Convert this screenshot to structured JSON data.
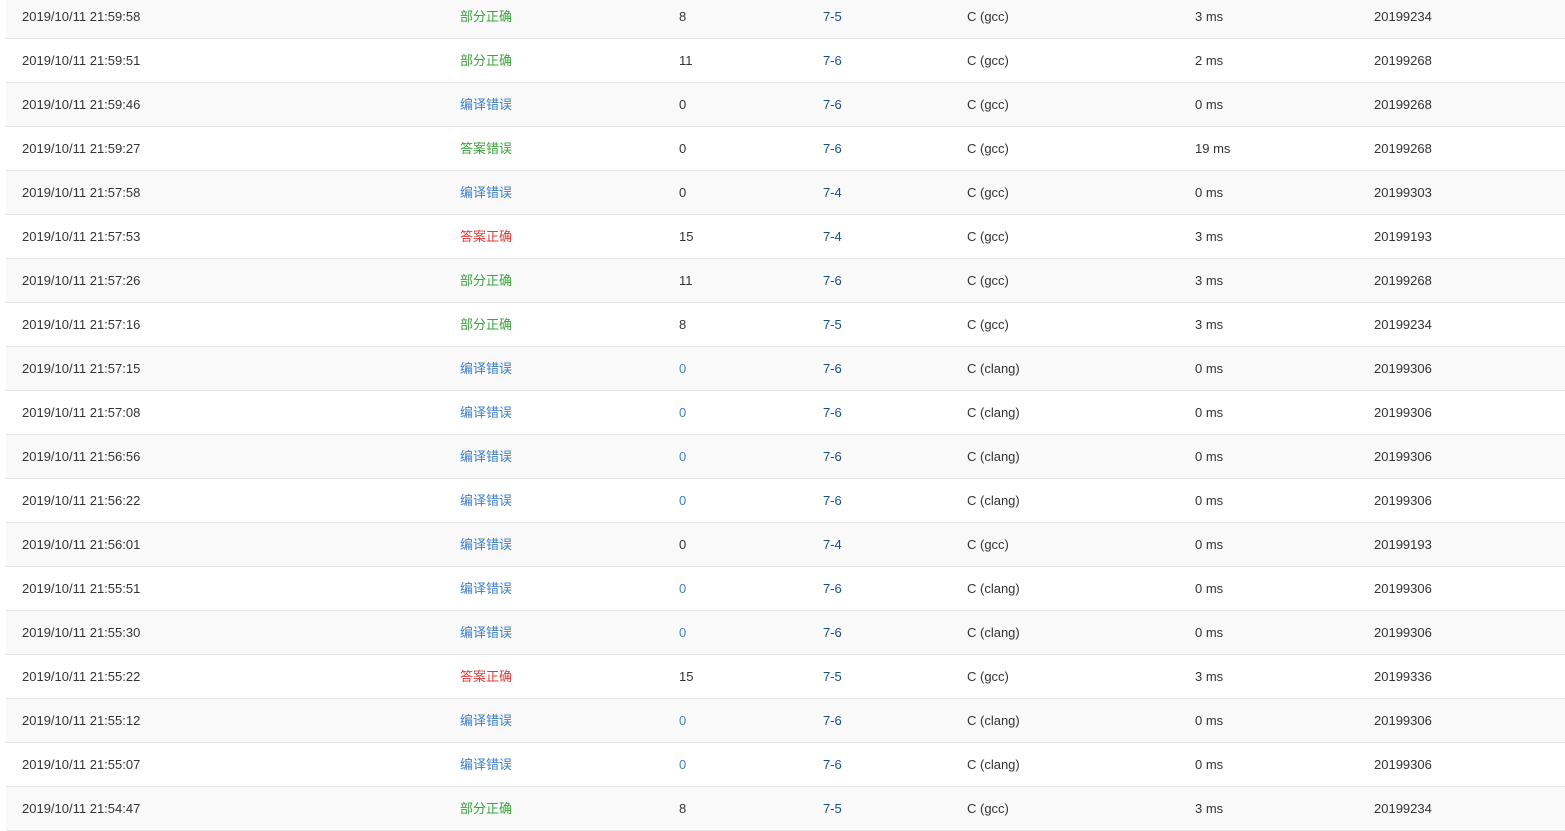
{
  "submissions": {
    "rows": [
      {
        "time": "2019/10/11 21:59:58",
        "status": "部分正确",
        "status_type": "partial",
        "score": "8",
        "problem": "7-5",
        "compiler": "C (gcc)",
        "time_used": "3 ms",
        "user": "20199234"
      },
      {
        "time": "2019/10/11 21:59:51",
        "status": "部分正确",
        "status_type": "partial",
        "score": "11",
        "problem": "7-6",
        "compiler": "C (gcc)",
        "time_used": "2 ms",
        "user": "20199268"
      },
      {
        "time": "2019/10/11 21:59:46",
        "status": "编译错误",
        "status_type": "compile",
        "score": "0",
        "problem": "7-6",
        "compiler": "C (gcc)",
        "time_used": "0 ms",
        "user": "20199268"
      },
      {
        "time": "2019/10/11 21:59:27",
        "status": "答案错误",
        "status_type": "wrong",
        "score": "0",
        "problem": "7-6",
        "compiler": "C (gcc)",
        "time_used": "19 ms",
        "user": "20199268"
      },
      {
        "time": "2019/10/11 21:57:58",
        "status": "编译错误",
        "status_type": "compile",
        "score": "0",
        "problem": "7-4",
        "compiler": "C (gcc)",
        "time_used": "0 ms",
        "user": "20199303"
      },
      {
        "time": "2019/10/11 21:57:53",
        "status": "答案正确",
        "status_type": "accepted",
        "score": "15",
        "problem": "7-4",
        "compiler": "C (gcc)",
        "time_used": "3 ms",
        "user": "20199193"
      },
      {
        "time": "2019/10/11 21:57:26",
        "status": "部分正确",
        "status_type": "partial",
        "score": "11",
        "problem": "7-6",
        "compiler": "C (gcc)",
        "time_used": "3 ms",
        "user": "20199268"
      },
      {
        "time": "2019/10/11 21:57:16",
        "status": "部分正确",
        "status_type": "partial",
        "score": "8",
        "problem": "7-5",
        "compiler": "C (gcc)",
        "time_used": "3 ms",
        "user": "20199234"
      },
      {
        "time": "2019/10/11 21:57:15",
        "status": "编译错误",
        "status_type": "compile",
        "score": "0",
        "score_link": true,
        "problem": "7-6",
        "compiler": "C (clang)",
        "time_used": "0 ms",
        "user": "20199306"
      },
      {
        "time": "2019/10/11 21:57:08",
        "status": "编译错误",
        "status_type": "compile",
        "score": "0",
        "score_link": true,
        "problem": "7-6",
        "compiler": "C (clang)",
        "time_used": "0 ms",
        "user": "20199306"
      },
      {
        "time": "2019/10/11 21:56:56",
        "status": "编译错误",
        "status_type": "compile",
        "score": "0",
        "score_link": true,
        "problem": "7-6",
        "compiler": "C (clang)",
        "time_used": "0 ms",
        "user": "20199306"
      },
      {
        "time": "2019/10/11 21:56:22",
        "status": "编译错误",
        "status_type": "compile",
        "score": "0",
        "score_link": true,
        "problem": "7-6",
        "compiler": "C (clang)",
        "time_used": "0 ms",
        "user": "20199306"
      },
      {
        "time": "2019/10/11 21:56:01",
        "status": "编译错误",
        "status_type": "compile",
        "score": "0",
        "problem": "7-4",
        "compiler": "C (gcc)",
        "time_used": "0 ms",
        "user": "20199193"
      },
      {
        "time": "2019/10/11 21:55:51",
        "status": "编译错误",
        "status_type": "compile",
        "score": "0",
        "score_link": true,
        "problem": "7-6",
        "compiler": "C (clang)",
        "time_used": "0 ms",
        "user": "20199306"
      },
      {
        "time": "2019/10/11 21:55:30",
        "status": "编译错误",
        "status_type": "compile",
        "score": "0",
        "score_link": true,
        "problem": "7-6",
        "compiler": "C (clang)",
        "time_used": "0 ms",
        "user": "20199306"
      },
      {
        "time": "2019/10/11 21:55:22",
        "status": "答案正确",
        "status_type": "accepted",
        "score": "15",
        "problem": "7-5",
        "compiler": "C (gcc)",
        "time_used": "3 ms",
        "user": "20199336"
      },
      {
        "time": "2019/10/11 21:55:12",
        "status": "编译错误",
        "status_type": "compile",
        "score": "0",
        "score_link": true,
        "problem": "7-6",
        "compiler": "C (clang)",
        "time_used": "0 ms",
        "user": "20199306"
      },
      {
        "time": "2019/10/11 21:55:07",
        "status": "编译错误",
        "status_type": "compile",
        "score": "0",
        "score_link": true,
        "problem": "7-6",
        "compiler": "C (clang)",
        "time_used": "0 ms",
        "user": "20199306"
      },
      {
        "time": "2019/10/11 21:54:47",
        "status": "部分正确",
        "status_type": "partial",
        "score": "8",
        "problem": "7-5",
        "compiler": "C (gcc)",
        "time_used": "3 ms",
        "user": "20199234"
      }
    ]
  },
  "colors": {
    "partial": "#3ca33c",
    "compile_error": "#3d7fc7",
    "wrong_answer": "#3ca33c",
    "accepted": "#e23b3b",
    "problem_link": "#1a4d8c",
    "row_alt": "#f9f9f9",
    "divider": "#e6e6e6"
  }
}
